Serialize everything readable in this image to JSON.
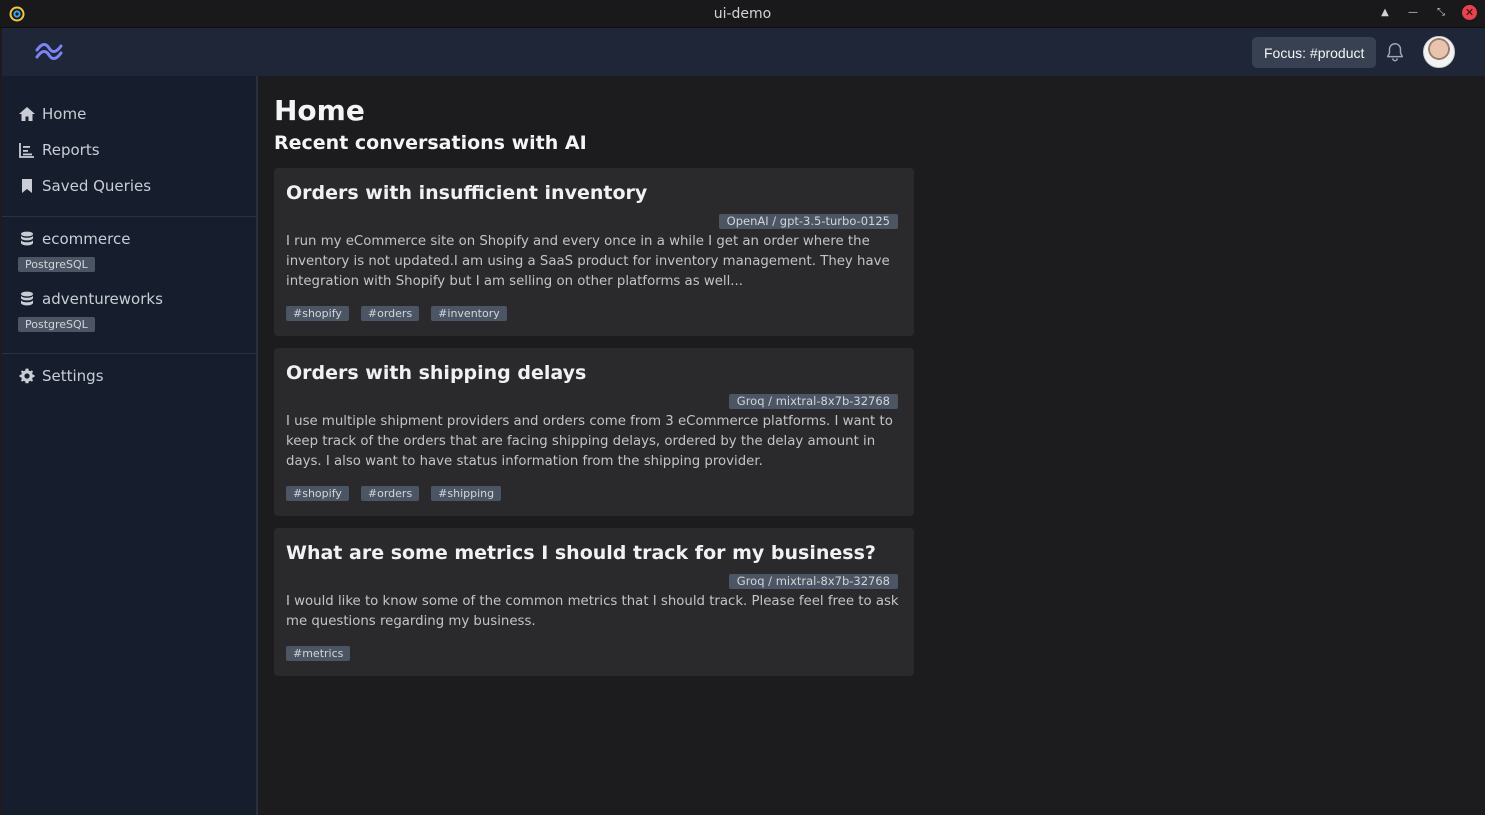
{
  "window": {
    "title": "ui-demo"
  },
  "header": {
    "focus_label": "Focus: #product"
  },
  "sidebar": {
    "nav": [
      {
        "label": "Home",
        "icon": "home-icon"
      },
      {
        "label": "Reports",
        "icon": "chart-icon"
      },
      {
        "label": "Saved Queries",
        "icon": "bookmark-icon"
      }
    ],
    "databases": [
      {
        "name": "ecommerce",
        "type": "PostgreSQL",
        "icon": "database-icon"
      },
      {
        "name": "adventureworks",
        "type": "PostgreSQL",
        "icon": "database-icon"
      }
    ],
    "settings_label": "Settings"
  },
  "main": {
    "title": "Home",
    "subtitle": "Recent conversations with AI",
    "conversations": [
      {
        "title": "Orders with insufficient inventory",
        "model": "OpenAI / gpt-3.5-turbo-0125",
        "description": "I run my eCommerce site on Shopify and every once in a while I get an order where the inventory is not updated.I am using a SaaS product for inventory management. They have integration with Shopify but I am selling on other platforms as well...",
        "tags": [
          "#shopify",
          "#orders",
          "#inventory"
        ]
      },
      {
        "title": "Orders with shipping delays",
        "model": "Groq / mixtral-8x7b-32768",
        "description": "I use multiple shipment providers and orders come from 3 eCommerce platforms. I want to keep track of the orders that are facing shipping delays, ordered by the delay amount in days. I also want to have status information from the shipping provider.",
        "tags": [
          "#shopify",
          "#orders",
          "#shipping"
        ]
      },
      {
        "title": "What are some metrics I should track for my business?",
        "model": "Groq / mixtral-8x7b-32768",
        "description": "I would like to know some of the common metrics that I should track. Please feel free to ask me questions regarding my business.",
        "tags": [
          "#metrics"
        ]
      }
    ]
  },
  "colors": {
    "header_bg": "#1e2637",
    "sidebar_bg": "#161d2c",
    "main_bg": "#1c1c1e",
    "card_bg": "#2a2a2d",
    "tag_bg": "#4b5563",
    "logo": "#7c83f2"
  }
}
